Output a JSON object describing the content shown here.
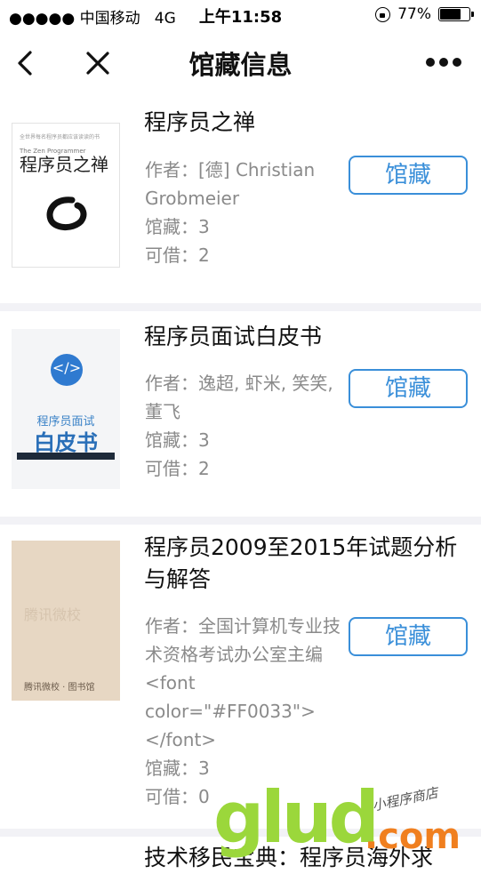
{
  "status_bar": {
    "carrier": "●●●●● 中国移动",
    "network": "4G",
    "time": "上午11:58",
    "battery_percent_text": "77%",
    "battery_level": 0.77
  },
  "nav": {
    "title": "馆藏信息",
    "back_icon": "chevron-left-icon",
    "close_icon": "close-icon",
    "more_icon": "more-dots-icon"
  },
  "books": [
    {
      "title": "程序员之禅",
      "author": "作者：[德] Christian Grobmeier",
      "holdings": "馆藏：3",
      "available": "可借：2",
      "button_label": "馆藏",
      "cover": {
        "small_line": "全世界每名程序员都应该读读的书",
        "eng": "The Zen Programmer",
        "title": "程序员之禅"
      }
    },
    {
      "title": "程序员面试白皮书",
      "author": "作者：逸超, 虾米, 笑笑, 董飞",
      "holdings": "馆藏：3",
      "available": "可借：2",
      "button_label": "馆藏",
      "cover": {
        "badge": "</>",
        "line1": "程序员面试",
        "line2": "白皮书"
      }
    },
    {
      "title": "程序员2009至2015年试题分析与解答",
      "author": "作者：全国计算机专业技术资格考试办公室主编　<font color=\"#FF0033\"></font>",
      "holdings": "馆藏：3",
      "available": "可借：0",
      "button_label": "馆藏",
      "cover": {
        "watermark": "腾讯微校",
        "footer": "腾讯微校 · 图书馆"
      }
    },
    {
      "title": "技术移民宝典：程序员海外求"
    }
  ],
  "watermark": {
    "main": "glud",
    "suffix": ".com",
    "tagline": "小程序商店"
  },
  "colors": {
    "accent": "#3a8fd9",
    "separator": "#f2f2f6",
    "meta_text": "#8a8a8a"
  }
}
